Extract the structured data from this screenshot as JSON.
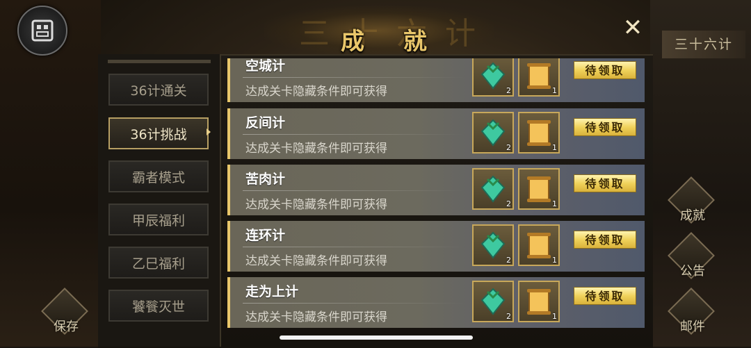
{
  "window": {
    "title": "成 就",
    "title_ghost": "三十六计"
  },
  "right_panel": {
    "label": "三十六计",
    "buttons": [
      {
        "label": "成就"
      },
      {
        "label": "公告"
      },
      {
        "label": "邮件"
      }
    ]
  },
  "left_panel": {
    "save_label": "保存"
  },
  "sidebar": {
    "tabs": [
      {
        "label": "36计通关"
      },
      {
        "label": "36计挑战"
      },
      {
        "label": "霸者模式"
      },
      {
        "label": "甲辰福利"
      },
      {
        "label": "乙巳福利"
      },
      {
        "label": "饕餮灭世"
      }
    ],
    "active_index": 1
  },
  "achievements": [
    {
      "title": "空城计",
      "description": "达成关卡隐藏条件即可获得",
      "reward_gem_count": "2",
      "reward_scroll_count": "1",
      "button": "待领取"
    },
    {
      "title": "反间计",
      "description": "达成关卡隐藏条件即可获得",
      "reward_gem_count": "2",
      "reward_scroll_count": "1",
      "button": "待领取"
    },
    {
      "title": "苦肉计",
      "description": "达成关卡隐藏条件即可获得",
      "reward_gem_count": "2",
      "reward_scroll_count": "1",
      "button": "待领取"
    },
    {
      "title": "连环计",
      "description": "达成关卡隐藏条件即可获得",
      "reward_gem_count": "2",
      "reward_scroll_count": "1",
      "button": "待领取"
    },
    {
      "title": "走为上计",
      "description": "达成关卡隐藏条件即可获得",
      "reward_gem_count": "2",
      "reward_scroll_count": "1",
      "button": "待领取"
    }
  ],
  "colors": {
    "accent_gold": "#e9c76b",
    "claim_button": "#f0d25b"
  }
}
